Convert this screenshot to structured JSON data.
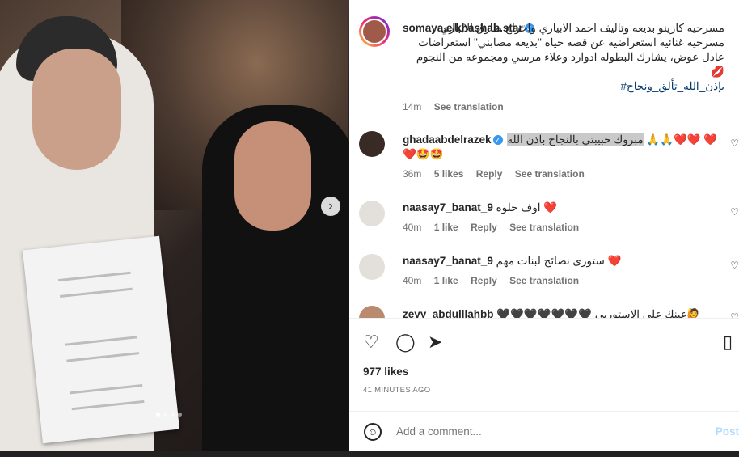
{
  "caption": {
    "username": "somaya.elkhashab.star",
    "text": "مسرحيه كازينو بديعه وتاليف احمد الابياري واخراج طارق الابياري مسرحيه غنائيه استعراضيه عن قصه حياه \"بديعه مصابني\" استعراضات عادل عوض، يشارك البطوله ادوارد وعلاء مرسي ومجموعه من النجوم 💋",
    "hashtags": "بإذن_الله_تألق_ونجاح#",
    "time": "14m",
    "see_translation": "See translation"
  },
  "comments": [
    {
      "username": "ghadaabdelrazek",
      "verified": true,
      "text": "مبروك حبيبتي بالنجاح باذن الله",
      "emoji": "🙏🙏❤️❤️ ❤️❤️🤩🤩",
      "time": "36m",
      "likes": "5 likes",
      "reply": "Reply",
      "see_translation": "See translation"
    },
    {
      "username": "naasay7_banat_9",
      "verified": false,
      "text": "اوف حلوه ❤️",
      "time": "40m",
      "likes": "1 like",
      "reply": "Reply",
      "see_translation": "See translation"
    },
    {
      "username": "naasay7_banat_9",
      "verified": false,
      "text": "ستورى نصائح لبنات مهم ❤️",
      "time": "40m",
      "likes": "1 like",
      "reply": "Reply",
      "see_translation": "See translation"
    },
    {
      "username": "zeyy_abdulllahbb",
      "verified": false,
      "text": "🖤🖤🖤🖤🖤🖤🖤 عينك على الاستوريي🙋",
      "time": "",
      "likes": "",
      "reply": "",
      "see_translation": ""
    }
  ],
  "actions": {
    "likes": "977 likes",
    "time": "41 MINUTES AGO"
  },
  "comment_bar": {
    "placeholder": "Add a comment...",
    "post": "Post"
  },
  "icons": {
    "like": "heart-icon",
    "comment": "comment-icon",
    "share": "share-icon",
    "save": "bookmark-icon",
    "emoji": "emoji-icon",
    "next": "chevron-right-icon"
  },
  "carousel": {
    "slides": 4,
    "current": 1
  }
}
